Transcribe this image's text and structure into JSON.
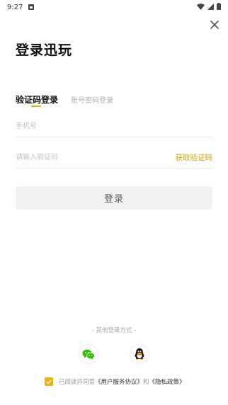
{
  "status_bar": {
    "time": "9:27"
  },
  "header": {
    "title": "登录迅玩"
  },
  "tabs": [
    {
      "label": "验证码登录",
      "active": true
    },
    {
      "label": "账号密码登录",
      "active": false
    }
  ],
  "form": {
    "phone_placeholder": "手机号",
    "code_placeholder": "请输入验证码",
    "get_code_label": "获取验证码",
    "login_label": "登录"
  },
  "other_login": {
    "title": "- 其他登录方式 -",
    "options": [
      "wechat-icon",
      "qq-icon"
    ]
  },
  "agreement": {
    "checked": true,
    "prefix": "已阅读并同意",
    "user_agreement": "《用户服务协议》",
    "and": "和",
    "privacy_policy": "《隐私政策》"
  },
  "colors": {
    "accent": "#f0b400",
    "link": "#d9a300",
    "wechat": "#2dc100",
    "button_bg": "#f2f2f2"
  }
}
